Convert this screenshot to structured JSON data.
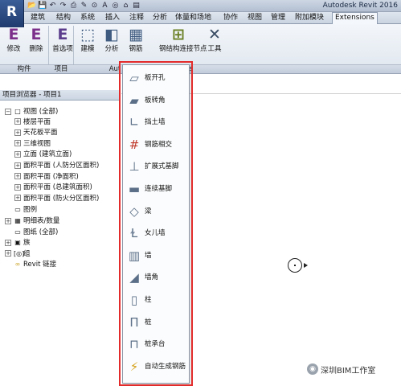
{
  "window": {
    "title": "Autodesk Revit 2016"
  },
  "app_button": {
    "label": "R"
  },
  "quick_access": [
    "📂",
    "💾",
    "↶",
    "↷",
    "⎙",
    "✎",
    "⊙",
    "A",
    "◎",
    "⌂",
    "▤"
  ],
  "tabs": [
    "建筑",
    "结构",
    "系统",
    "插入",
    "注释",
    "分析",
    "体量和场地",
    "协作",
    "视图",
    "管理",
    "附加模块",
    "Extensions"
  ],
  "active_tab": "Extensions",
  "ribbon": {
    "buttons": [
      {
        "label": "修改",
        "icon": "E"
      },
      {
        "label": "删除",
        "icon": "E"
      },
      {
        "label": "首选项",
        "icon": "E"
      },
      {
        "label": "建模",
        "icon": "⬚"
      },
      {
        "label": "分析",
        "icon": "◧"
      },
      {
        "label": "钢筋",
        "icon": "▦"
      },
      {
        "label": "钢结构连接节点",
        "icon": "⊞"
      },
      {
        "label": "工具",
        "icon": "✕"
      }
    ],
    "panels": [
      "构件",
      "项目",
      "Aut",
      "s"
    ]
  },
  "project_browser": {
    "title": "项目浏览器 - 项目1",
    "items": [
      {
        "label": "视图 (全部)",
        "depth": 0,
        "toggle": "−",
        "icon": "□"
      },
      {
        "label": "楼层平面",
        "depth": 1,
        "toggle": "+"
      },
      {
        "label": "天花板平面",
        "depth": 1,
        "toggle": "+"
      },
      {
        "label": "三维视图",
        "depth": 1,
        "toggle": "+"
      },
      {
        "label": "立面 (建筑立面)",
        "depth": 1,
        "toggle": "+"
      },
      {
        "label": "面积平面 (人防分区面积)",
        "depth": 1,
        "toggle": "+"
      },
      {
        "label": "面积平面 (净面积)",
        "depth": 1,
        "toggle": "+"
      },
      {
        "label": "面积平面 (总建筑面积)",
        "depth": 1,
        "toggle": "+"
      },
      {
        "label": "面积平面 (防火分区面积)",
        "depth": 1,
        "toggle": "+"
      },
      {
        "label": "图例",
        "depth": 0,
        "toggle": "",
        "icon": "▭"
      },
      {
        "label": "明细表/数量",
        "depth": 0,
        "toggle": "+",
        "icon": "▦"
      },
      {
        "label": "图纸 (全部)",
        "depth": 0,
        "toggle": "",
        "icon": "▭"
      },
      {
        "label": "族",
        "depth": 0,
        "toggle": "+",
        "icon": "▣"
      },
      {
        "label": "组",
        "depth": 0,
        "toggle": "+",
        "icon": "[◎]"
      },
      {
        "label": "Revit 链接",
        "depth": 0,
        "toggle": "",
        "icon": "∞"
      }
    ]
  },
  "rebar_menu": {
    "items": [
      {
        "label": "板开孔",
        "icon": "▱"
      },
      {
        "label": "板转角",
        "icon": "▰"
      },
      {
        "label": "挡土墙",
        "icon": "∟"
      },
      {
        "label": "钢筋相交",
        "icon": "#"
      },
      {
        "label": "扩展式基脚",
        "icon": "⊥"
      },
      {
        "label": "连续基脚",
        "icon": "▬"
      },
      {
        "label": "梁",
        "icon": "◇"
      },
      {
        "label": "女儿墙",
        "icon": "Ɫ"
      },
      {
        "label": "墙",
        "icon": "▥"
      },
      {
        "label": "墙角",
        "icon": "◢"
      },
      {
        "label": "柱",
        "icon": "▯"
      },
      {
        "label": "桩",
        "icon": "Π"
      },
      {
        "label": "桩承台",
        "icon": "⊓"
      },
      {
        "label": "自动生成钢筋",
        "icon": "⚡"
      }
    ]
  },
  "watermark": {
    "text": "深圳BIM工作室",
    "icon": "◉"
  }
}
